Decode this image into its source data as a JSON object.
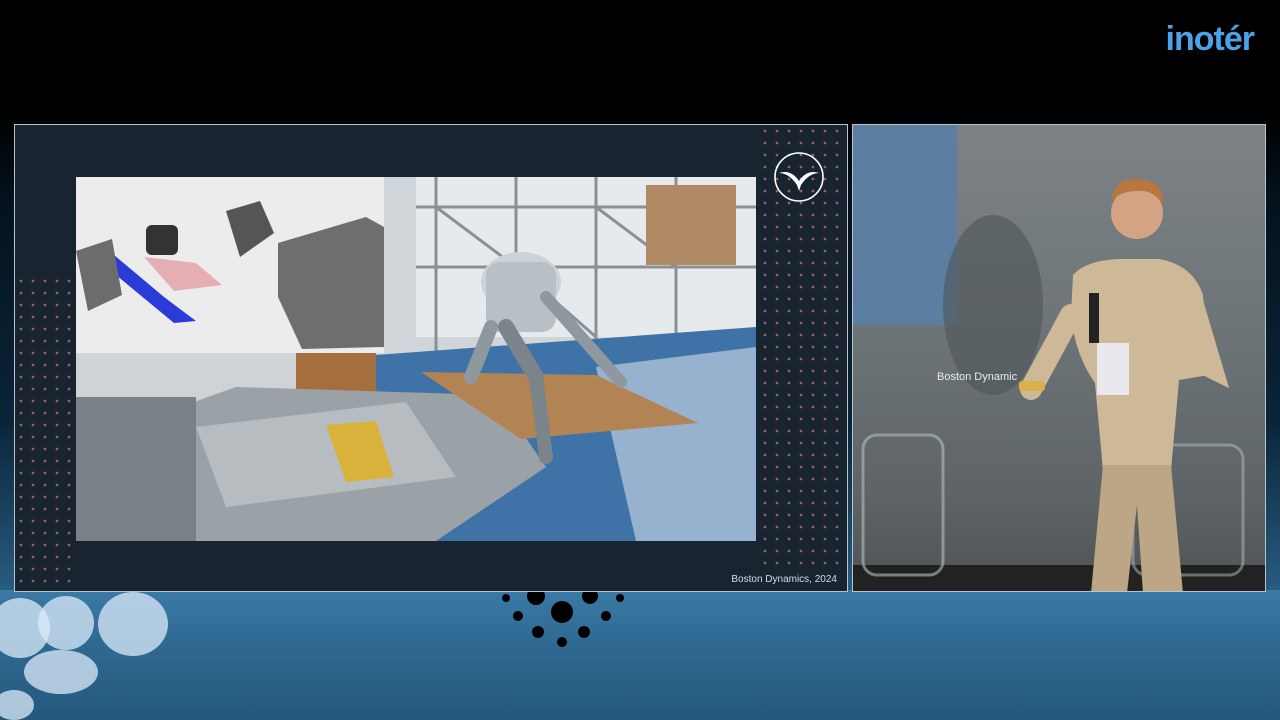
{
  "brand": {
    "logo_text": "inotér"
  },
  "slide": {
    "credit": "Boston Dynamics, 2024",
    "icon": "swallow-bird-icon"
  },
  "camera": {
    "projection_text": "Boston Dynamic"
  },
  "colors": {
    "accent": "#4aa3e6",
    "slide_bg": "#182531"
  }
}
